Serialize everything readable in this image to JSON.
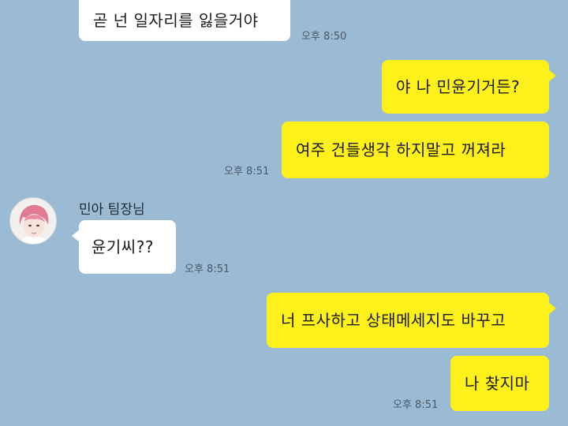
{
  "chat": {
    "messages": [
      {
        "text": "곧 넌 일자리를 잃을거야",
        "time": "오후 8:50",
        "side": "left"
      },
      {
        "text": "야 나 민윤기거든?",
        "side": "right"
      },
      {
        "text": "여주 건들생각 하지말고 꺼져라",
        "time": "오후 8:51",
        "side": "right"
      },
      {
        "sender": "민아 팀장님",
        "text": "윤기씨??",
        "time": "오후 8:51",
        "side": "left"
      },
      {
        "text": "너 프사하고 상태메세지도 바꾸고",
        "side": "right"
      },
      {
        "text": "나 찾지마",
        "time": "오후 8:51",
        "side": "right"
      }
    ]
  },
  "colors": {
    "background": "#9bbbd4",
    "my_bubble": "#fef01b",
    "other_bubble": "#ffffff"
  }
}
